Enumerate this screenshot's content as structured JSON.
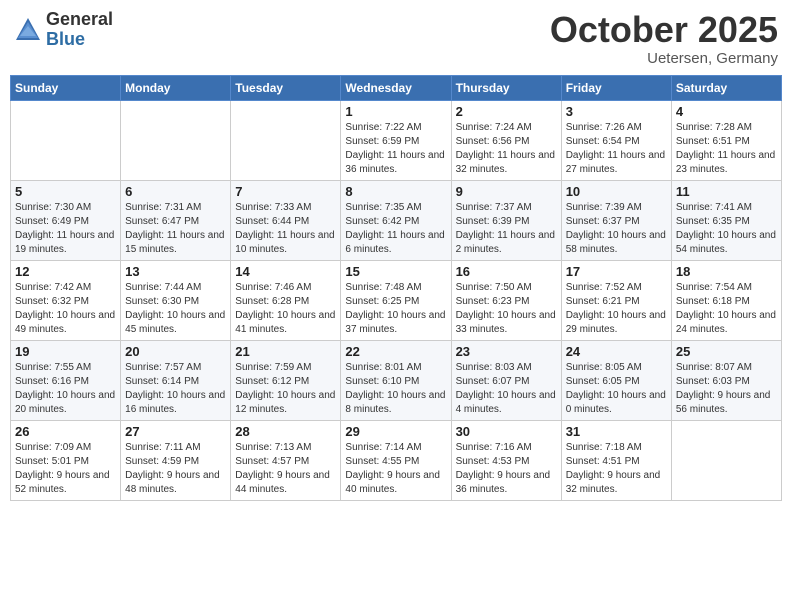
{
  "header": {
    "logo_line1": "General",
    "logo_line2": "Blue",
    "month": "October 2025",
    "location": "Uetersen, Germany"
  },
  "weekdays": [
    "Sunday",
    "Monday",
    "Tuesday",
    "Wednesday",
    "Thursday",
    "Friday",
    "Saturday"
  ],
  "weeks": [
    [
      {
        "day": "",
        "info": ""
      },
      {
        "day": "",
        "info": ""
      },
      {
        "day": "",
        "info": ""
      },
      {
        "day": "1",
        "info": "Sunrise: 7:22 AM\nSunset: 6:59 PM\nDaylight: 11 hours\nand 36 minutes."
      },
      {
        "day": "2",
        "info": "Sunrise: 7:24 AM\nSunset: 6:56 PM\nDaylight: 11 hours\nand 32 minutes."
      },
      {
        "day": "3",
        "info": "Sunrise: 7:26 AM\nSunset: 6:54 PM\nDaylight: 11 hours\nand 27 minutes."
      },
      {
        "day": "4",
        "info": "Sunrise: 7:28 AM\nSunset: 6:51 PM\nDaylight: 11 hours\nand 23 minutes."
      }
    ],
    [
      {
        "day": "5",
        "info": "Sunrise: 7:30 AM\nSunset: 6:49 PM\nDaylight: 11 hours\nand 19 minutes."
      },
      {
        "day": "6",
        "info": "Sunrise: 7:31 AM\nSunset: 6:47 PM\nDaylight: 11 hours\nand 15 minutes."
      },
      {
        "day": "7",
        "info": "Sunrise: 7:33 AM\nSunset: 6:44 PM\nDaylight: 11 hours\nand 10 minutes."
      },
      {
        "day": "8",
        "info": "Sunrise: 7:35 AM\nSunset: 6:42 PM\nDaylight: 11 hours\nand 6 minutes."
      },
      {
        "day": "9",
        "info": "Sunrise: 7:37 AM\nSunset: 6:39 PM\nDaylight: 11 hours\nand 2 minutes."
      },
      {
        "day": "10",
        "info": "Sunrise: 7:39 AM\nSunset: 6:37 PM\nDaylight: 10 hours\nand 58 minutes."
      },
      {
        "day": "11",
        "info": "Sunrise: 7:41 AM\nSunset: 6:35 PM\nDaylight: 10 hours\nand 54 minutes."
      }
    ],
    [
      {
        "day": "12",
        "info": "Sunrise: 7:42 AM\nSunset: 6:32 PM\nDaylight: 10 hours\nand 49 minutes."
      },
      {
        "day": "13",
        "info": "Sunrise: 7:44 AM\nSunset: 6:30 PM\nDaylight: 10 hours\nand 45 minutes."
      },
      {
        "day": "14",
        "info": "Sunrise: 7:46 AM\nSunset: 6:28 PM\nDaylight: 10 hours\nand 41 minutes."
      },
      {
        "day": "15",
        "info": "Sunrise: 7:48 AM\nSunset: 6:25 PM\nDaylight: 10 hours\nand 37 minutes."
      },
      {
        "day": "16",
        "info": "Sunrise: 7:50 AM\nSunset: 6:23 PM\nDaylight: 10 hours\nand 33 minutes."
      },
      {
        "day": "17",
        "info": "Sunrise: 7:52 AM\nSunset: 6:21 PM\nDaylight: 10 hours\nand 29 minutes."
      },
      {
        "day": "18",
        "info": "Sunrise: 7:54 AM\nSunset: 6:18 PM\nDaylight: 10 hours\nand 24 minutes."
      }
    ],
    [
      {
        "day": "19",
        "info": "Sunrise: 7:55 AM\nSunset: 6:16 PM\nDaylight: 10 hours\nand 20 minutes."
      },
      {
        "day": "20",
        "info": "Sunrise: 7:57 AM\nSunset: 6:14 PM\nDaylight: 10 hours\nand 16 minutes."
      },
      {
        "day": "21",
        "info": "Sunrise: 7:59 AM\nSunset: 6:12 PM\nDaylight: 10 hours\nand 12 minutes."
      },
      {
        "day": "22",
        "info": "Sunrise: 8:01 AM\nSunset: 6:10 PM\nDaylight: 10 hours\nand 8 minutes."
      },
      {
        "day": "23",
        "info": "Sunrise: 8:03 AM\nSunset: 6:07 PM\nDaylight: 10 hours\nand 4 minutes."
      },
      {
        "day": "24",
        "info": "Sunrise: 8:05 AM\nSunset: 6:05 PM\nDaylight: 10 hours\nand 0 minutes."
      },
      {
        "day": "25",
        "info": "Sunrise: 8:07 AM\nSunset: 6:03 PM\nDaylight: 9 hours\nand 56 minutes."
      }
    ],
    [
      {
        "day": "26",
        "info": "Sunrise: 7:09 AM\nSunset: 5:01 PM\nDaylight: 9 hours\nand 52 minutes."
      },
      {
        "day": "27",
        "info": "Sunrise: 7:11 AM\nSunset: 4:59 PM\nDaylight: 9 hours\nand 48 minutes."
      },
      {
        "day": "28",
        "info": "Sunrise: 7:13 AM\nSunset: 4:57 PM\nDaylight: 9 hours\nand 44 minutes."
      },
      {
        "day": "29",
        "info": "Sunrise: 7:14 AM\nSunset: 4:55 PM\nDaylight: 9 hours\nand 40 minutes."
      },
      {
        "day": "30",
        "info": "Sunrise: 7:16 AM\nSunset: 4:53 PM\nDaylight: 9 hours\nand 36 minutes."
      },
      {
        "day": "31",
        "info": "Sunrise: 7:18 AM\nSunset: 4:51 PM\nDaylight: 9 hours\nand 32 minutes."
      },
      {
        "day": "",
        "info": ""
      }
    ]
  ]
}
